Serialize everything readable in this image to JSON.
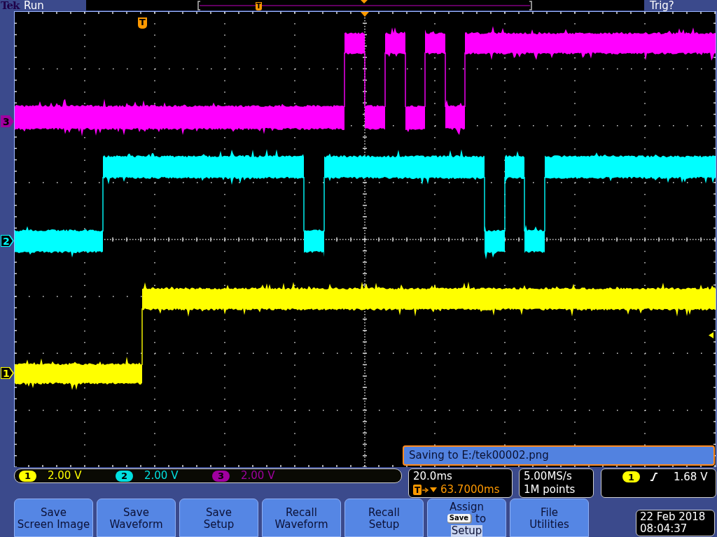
{
  "top_bar": {
    "brand": "Tek",
    "acquisition_state": "Run",
    "trigger_state": "Trig?",
    "record_view": {
      "trigger_marker": "T"
    }
  },
  "display": {
    "trigger_marker": "T",
    "message": "Saving to E:/tek00002.png"
  },
  "level_markers": [
    {
      "label": "3",
      "color": "#a000a0",
      "selected": true
    },
    {
      "label": "2",
      "color": "#00ffff",
      "selected": false
    },
    {
      "label": "1",
      "color": "#ffff00",
      "selected": false
    }
  ],
  "traces": [
    {
      "color": "#ffff00"
    },
    {
      "color": "#00ffff"
    },
    {
      "color": "#ff00ff"
    }
  ],
  "channels": [
    {
      "badge": "1",
      "scale": "2.00 V",
      "color": "#ffff00"
    },
    {
      "badge": "2",
      "scale": "2.00 V",
      "color": "#00e0e0"
    },
    {
      "badge": "3",
      "scale": "2.00 V",
      "color": "#a000a0"
    }
  ],
  "timebase": {
    "scale": "20.0ms",
    "delay_marker": "T",
    "delay": "63.7000ms"
  },
  "acquisition": {
    "sample_rate": "5.00MS/s",
    "record_length": "1M points"
  },
  "trigger": {
    "source": "1",
    "threshold": "1.68 V"
  },
  "menu_buttons": [
    {
      "kind": "label",
      "lines": [
        "Save",
        "Screen Image"
      ]
    },
    {
      "kind": "label",
      "lines": [
        "Save",
        "Waveform"
      ]
    },
    {
      "kind": "label",
      "lines": [
        "Save",
        "Setup"
      ]
    },
    {
      "kind": "label",
      "lines": [
        "Recall",
        "Waveform"
      ]
    },
    {
      "kind": "label",
      "lines": [
        "Recall",
        "Setup"
      ]
    },
    {
      "kind": "assign",
      "lines": [
        "Assign"
      ],
      "key": "Save",
      "connector": "to",
      "target": "Setup",
      "target_highlighted": true
    },
    {
      "kind": "label",
      "lines": [
        "File",
        "Utilities"
      ]
    }
  ],
  "clock": {
    "date": "22 Feb 2018",
    "time": "08:04:37"
  }
}
